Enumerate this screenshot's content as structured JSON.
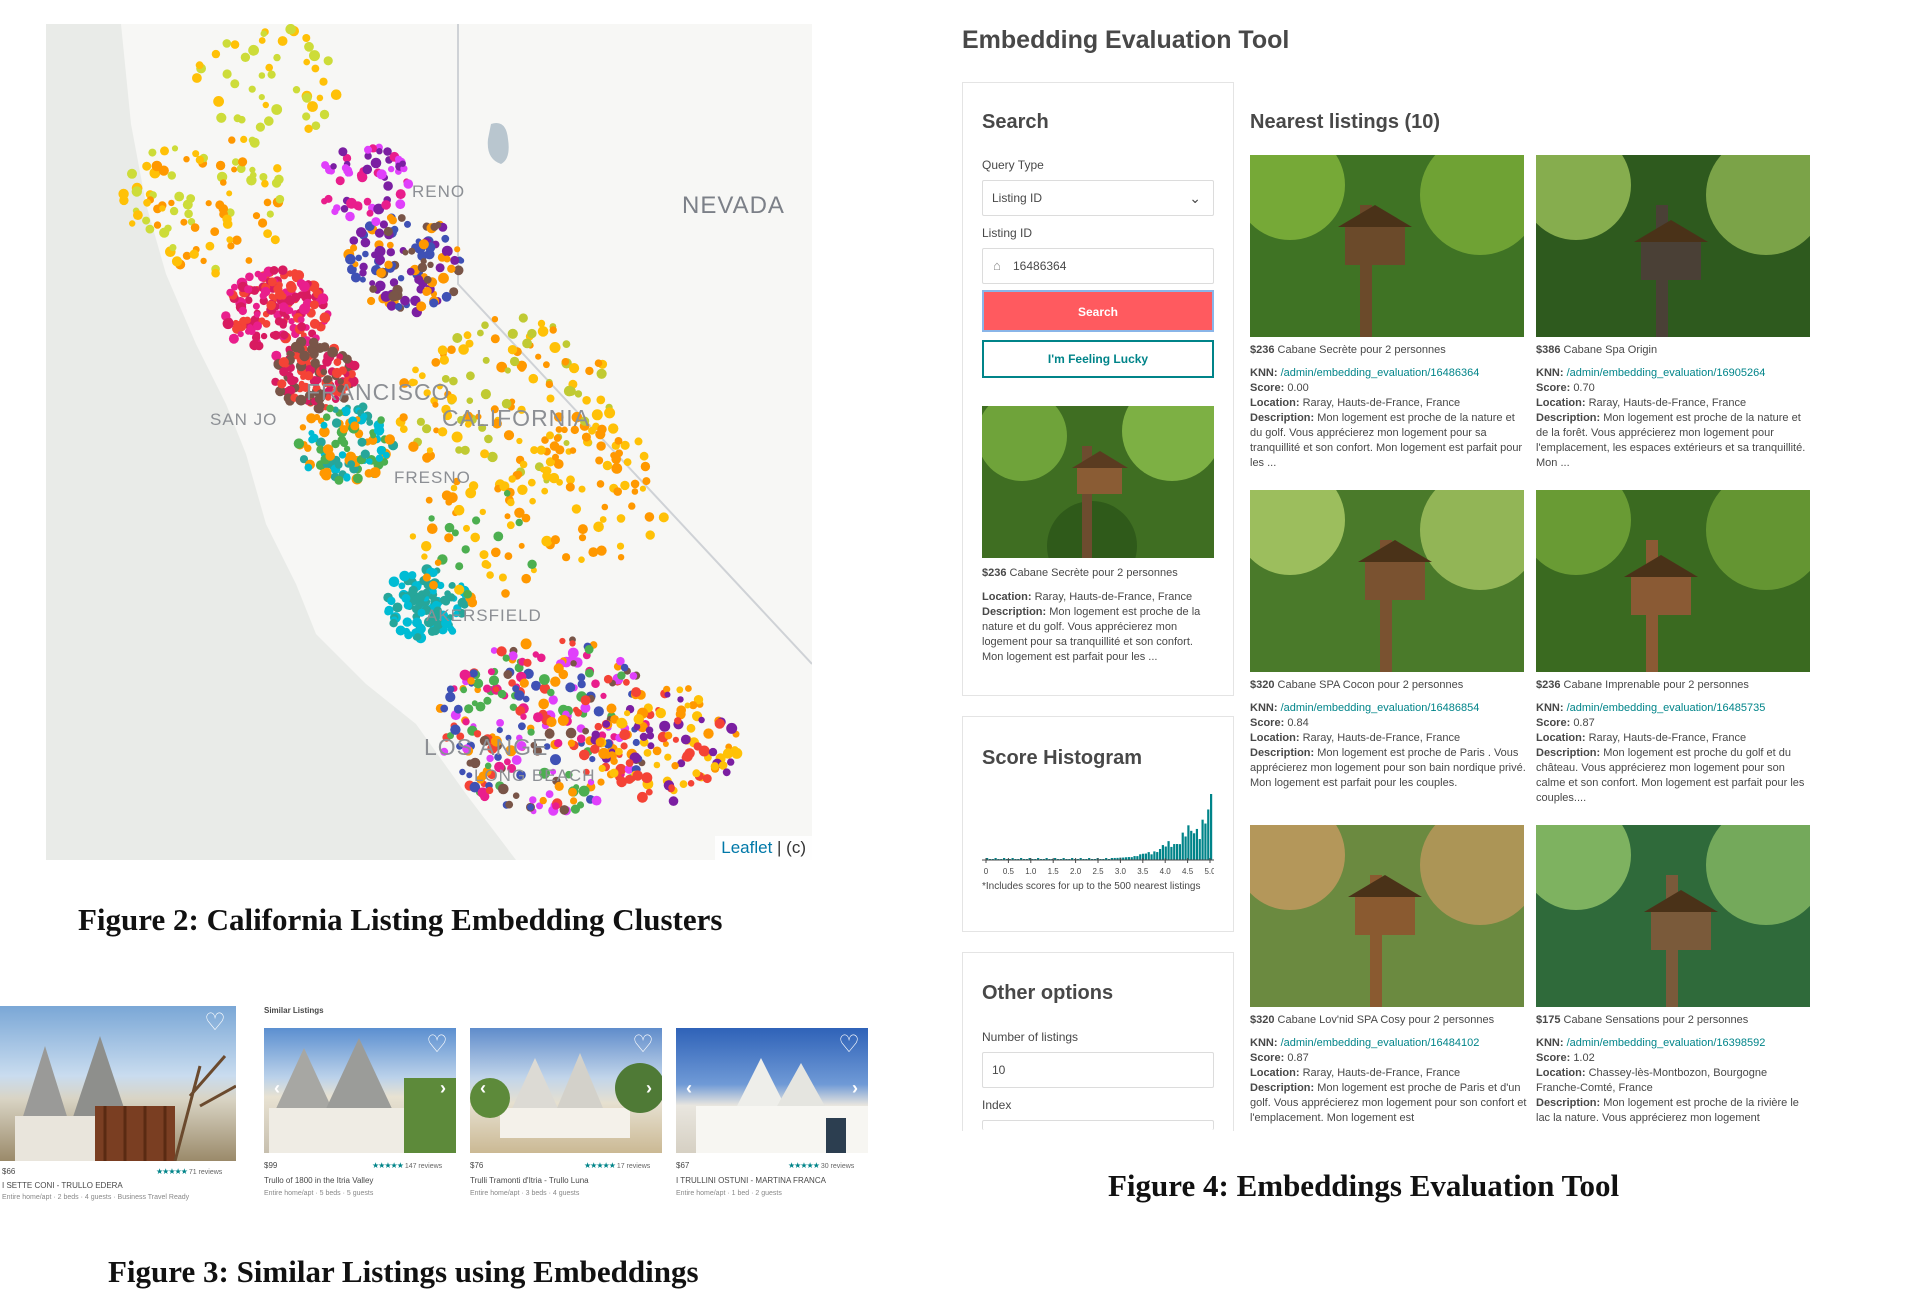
{
  "figure2": {
    "caption": "Figure 2: California Listing Embedding Clusters",
    "map_labels": {
      "reno": "RENO",
      "nevada": "NEVADA",
      "san_francisco": "FRANCISCO",
      "san_jose": "SAN JO",
      "california": "CALIFORNIA",
      "fresno": "FRESNO",
      "bakersfield": "AKERSFIELD",
      "los_angeles": "LOS ANGE",
      "long_beach": "LONG BEACH"
    },
    "attribution": {
      "link": "Leaflet",
      "rest": "| (c)"
    },
    "cluster_colors": [
      "#e91e8c",
      "#d81b60",
      "#ff9800",
      "#ffc107",
      "#cddc39",
      "#4caf50",
      "#2e7d32",
      "#26a69a",
      "#00bcd4",
      "#3f51b5",
      "#7b1fa2",
      "#f44336",
      "#795548",
      "#c0ca33",
      "#e040fb"
    ]
  },
  "figure3": {
    "caption": "Figure 3: Similar Listings using Embeddings",
    "section_title": "Similar Listings",
    "main_listing": {
      "price": "$66",
      "rating_text": "71 reviews",
      "name": "I SETTE CONI - TRULLO EDERA",
      "meta": "Entire home/apt · 2 beds · 4 guests · Business Travel Ready"
    },
    "listings": [
      {
        "price": "$99",
        "rating_text": "147 reviews",
        "name": "Trullo of 1800 in the Itria Valley",
        "meta": "Entire home/apt · 5 beds · 5 guests"
      },
      {
        "price": "$76",
        "rating_text": "17 reviews",
        "name": "Trulli Tramonti d'Itria - Trullo Luna",
        "meta": "Entire home/apt · 3 beds · 4 guests"
      },
      {
        "price": "$67",
        "rating_text": "30 reviews",
        "name": "I TRULLINI OSTUNI - MARTINA FRANCA",
        "meta": "Entire home/apt · 1 bed · 2 guests"
      }
    ],
    "stars": "★★★★★"
  },
  "figure4": {
    "caption": "Figure 4: Embeddings Evaluation Tool",
    "title": "Embedding Evaluation Tool",
    "search": {
      "heading": "Search",
      "query_type_label": "Query Type",
      "query_type_value": "Listing ID",
      "listing_id_label": "Listing ID",
      "listing_id_value": "16486364",
      "search_button": "Search",
      "lucky_button": "I'm Feeling Lucky",
      "result_price": "$236",
      "result_name": "Cabane Secrète pour 2 personnes",
      "result_location_label": "Location:",
      "result_location": "Raray, Hauts-de-France, France",
      "result_description_label": "Description:",
      "result_description": "Mon logement est proche de la nature et du golf. Vous apprécierez mon logement pour sa tranquillité et son confort. Mon logement est parfait pour les ..."
    },
    "histogram": {
      "heading": "Score Histogram",
      "ticks": [
        "0",
        "0.5",
        "1.0",
        "1.5",
        "2.0",
        "2.5",
        "3.0",
        "3.5",
        "4.0",
        "4.5",
        "5.0"
      ],
      "note": "*Includes scores for up to the 500 nearest listings"
    },
    "other_options": {
      "heading": "Other options",
      "number_label": "Number of listings",
      "number_value": "10",
      "index_label": "Index"
    },
    "nearest": {
      "heading": "Nearest listings (10)",
      "knn_label": "KNN:",
      "score_label": "Score:",
      "location_label": "Location:",
      "description_label": "Description:",
      "items": [
        {
          "price": "$236",
          "name": "Cabane Secrète pour 2 personnes",
          "knn": "/admin/embedding_evaluation/16486364",
          "score": "0.00",
          "location": "Raray, Hauts-de-France, France",
          "description": "Mon logement est proche de la nature et du golf. Vous apprécierez mon logement pour sa tranquillité et son confort. Mon logement est parfait pour les ..."
        },
        {
          "price": "$386",
          "name": "Cabane Spa Origin",
          "knn": "/admin/embedding_evaluation/16905264",
          "score": "0.70",
          "location": "Raray, Hauts-de-France, France",
          "description": "Mon logement est proche de la nature et de la forêt. Vous apprécierez mon logement pour l'emplacement, les espaces extérieurs et sa tranquillité. Mon ..."
        },
        {
          "price": "$320",
          "name": "Cabane SPA Cocon pour 2 personnes",
          "knn": "/admin/embedding_evaluation/16486854",
          "score": "0.84",
          "location": "Raray, Hauts-de-France, France",
          "description": "Mon logement est proche de Paris . Vous apprécierez mon logement pour son bain nordique privé. Mon logement est parfait pour les couples."
        },
        {
          "price": "$236",
          "name": "Cabane Imprenable pour 2 personnes",
          "knn": "/admin/embedding_evaluation/16485735",
          "score": "0.87",
          "location": "Raray, Hauts-de-France, France",
          "description": "Mon logement est proche du golf et du château. Vous apprécierez mon logement pour son calme et son confort. Mon logement est parfait pour les couples...."
        },
        {
          "price": "$320",
          "name": "Cabane Lov'nid SPA Cosy pour 2 personnes",
          "knn": "/admin/embedding_evaluation/16484102",
          "score": "0.87",
          "location": "Raray, Hauts-de-France, France",
          "description": "Mon logement est proche de Paris et d'un golf. Vous apprécierez mon logement pour son confort et l'emplacement. Mon logement est"
        },
        {
          "price": "$175",
          "name": "Cabane Sensations pour 2 personnes",
          "knn": "/admin/embedding_evaluation/16398592",
          "score": "1.02",
          "location": "Chassey-lès-Montbozon, Bourgogne Franche-Comté, France",
          "description": "Mon logement est proche de la rivière le lac la nature. Vous apprécierez mon logement"
        }
      ]
    }
  }
}
